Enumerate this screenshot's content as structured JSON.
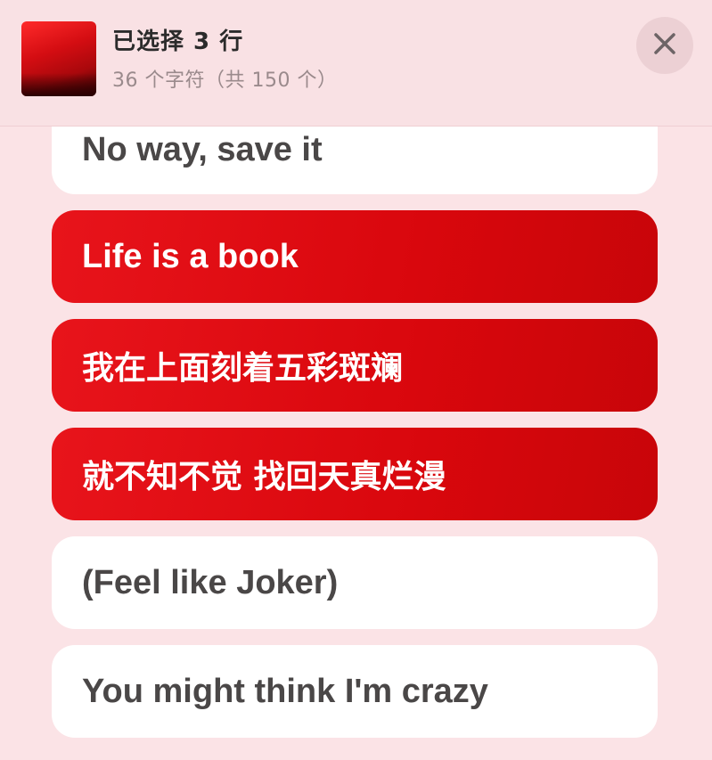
{
  "header": {
    "title": "已选择 3 行",
    "subtitle": "36 个字符（共 150 个）",
    "album_art": "album-artwork",
    "close_icon": "close-icon"
  },
  "lyrics": [
    {
      "text": "No way, save it",
      "selected": false
    },
    {
      "text": "Life is a book",
      "selected": true
    },
    {
      "text": "我在上面刻着五彩斑斓",
      "selected": true
    },
    {
      "text": "就不知不觉 找回天真烂漫",
      "selected": true
    },
    {
      "text": "(Feel like Joker)",
      "selected": false
    },
    {
      "text": "You might think I'm crazy",
      "selected": false
    }
  ],
  "colors": {
    "selected": "#e0101a",
    "unselected": "#ffffff",
    "background": "#fbe3e6"
  }
}
